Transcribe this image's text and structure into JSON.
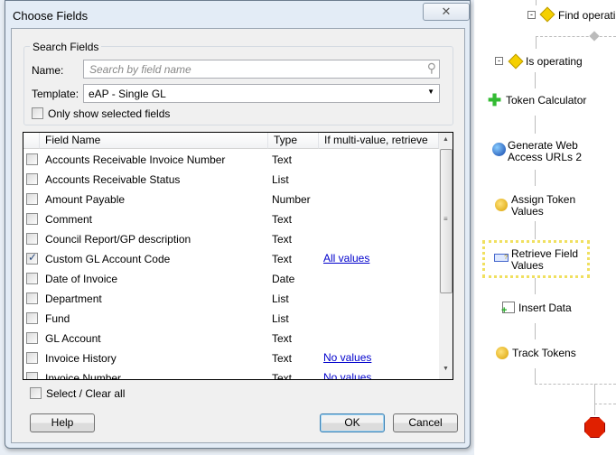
{
  "dialog": {
    "title": "Choose Fields",
    "close": "✕"
  },
  "search": {
    "group_label": "Search Fields",
    "name_label": "Name:",
    "name_placeholder": "Search by field name",
    "template_label": "Template:",
    "template_value": "eAP - Single GL",
    "only_selected": "Only show selected fields"
  },
  "list": {
    "headers": [
      "Field Name",
      "Type",
      "If multi-value, retrieve"
    ],
    "rows": [
      {
        "name": "Accounts Receivable Invoice Number",
        "type": "Text",
        "retrieve": "",
        "checked": false
      },
      {
        "name": "Accounts Receivable Status",
        "type": "List",
        "retrieve": "",
        "checked": false
      },
      {
        "name": "Amount Payable",
        "type": "Number",
        "retrieve": "",
        "checked": false
      },
      {
        "name": "Comment",
        "type": "Text",
        "retrieve": "",
        "checked": false
      },
      {
        "name": "Council Report/GP description",
        "type": "Text",
        "retrieve": "",
        "checked": false
      },
      {
        "name": "Custom GL Account Code",
        "type": "Text",
        "retrieve": "All values",
        "checked": true
      },
      {
        "name": "Date of Invoice",
        "type": "Date",
        "retrieve": "",
        "checked": false
      },
      {
        "name": "Department",
        "type": "List",
        "retrieve": "",
        "checked": false
      },
      {
        "name": "Fund",
        "type": "List",
        "retrieve": "",
        "checked": false
      },
      {
        "name": "GL Account",
        "type": "Text",
        "retrieve": "",
        "checked": false
      },
      {
        "name": "Invoice History",
        "type": "Text",
        "retrieve": "No values",
        "checked": false
      },
      {
        "name": "Invoice Number",
        "type": "Text",
        "retrieve": "No values",
        "checked": false
      }
    ]
  },
  "select_all": "Select / Clear all",
  "buttons": {
    "help": "Help",
    "ok": "OK",
    "cancel": "Cancel"
  },
  "workflow": [
    "Find operating",
    "Is operating",
    "Token Calculator",
    "Generate Web Access URLs 2",
    "Assign Token Values",
    "Retrieve Field Values",
    "Insert Data",
    "Track Tokens"
  ]
}
